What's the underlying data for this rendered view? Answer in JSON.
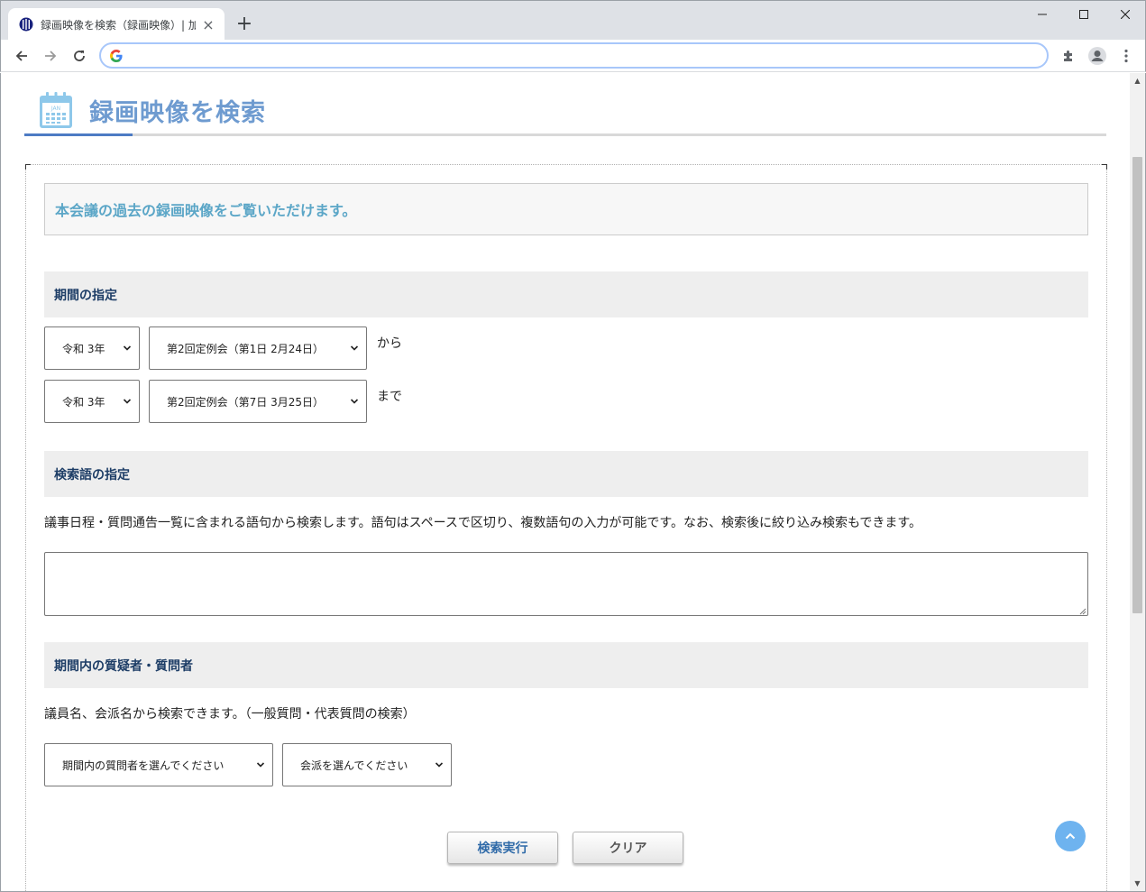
{
  "browser": {
    "tab_title": "録画映像を検索（録画映像）| 加",
    "new_tab_symbol": "+",
    "close_symbol": "×",
    "url": ""
  },
  "page": {
    "title": "録画映像を検索",
    "calendar_icon_text": "JAN",
    "intro": "本会議の過去の録画映像をご覧いただけます。"
  },
  "period": {
    "heading": "期間の指定",
    "from_year": "令和 3年",
    "from_session": "第2回定例会（第1日 2月24日）",
    "from_suffix": "から",
    "to_year": "令和 3年",
    "to_session": "第2回定例会（第7日 3月25日）",
    "to_suffix": "まで"
  },
  "keyword": {
    "heading": "検索語の指定",
    "description": "議事日程・質問通告一覧に含まれる語句から検索します。語句はスペースで区切り、複数語句の入力が可能です。なお、検索後に絞り込み検索もできます。",
    "value": ""
  },
  "questioner": {
    "heading": "期間内の質疑者・質問者",
    "description": "議員名、会派名から検索できます。（一般質問・代表質問の検索）",
    "member_select": "期間内の質問者を選んでください",
    "faction_select": "会派を選んでください"
  },
  "actions": {
    "search": "検索実行",
    "clear": "クリア"
  },
  "colors": {
    "title": "#6e9bd0",
    "intro": "#5ba6c7",
    "section_heading": "#1d3d66",
    "accent_line": "#4d7bc4",
    "to_top": "#6eb3ef"
  }
}
